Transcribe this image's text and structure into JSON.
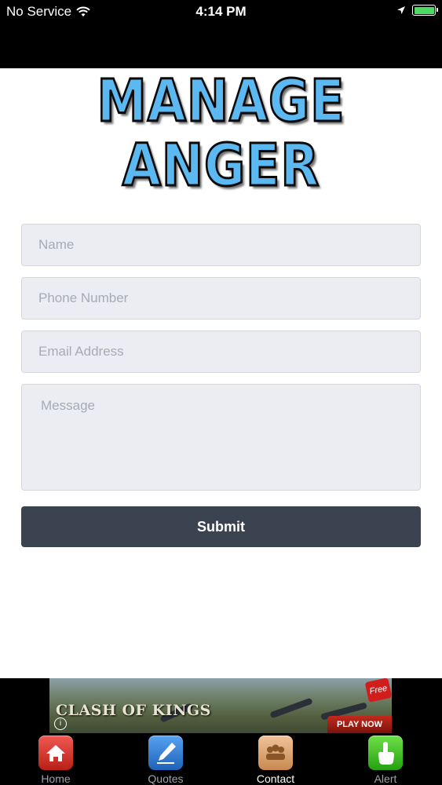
{
  "status_bar": {
    "carrier": "No Service",
    "time": "4:14 PM",
    "icons": [
      "wifi-icon",
      "location-arrow-icon",
      "battery-icon"
    ]
  },
  "logo": {
    "line1": "MANAGE",
    "line2": "ANGER",
    "color": "#5cb8f0"
  },
  "form": {
    "name_placeholder": "Name",
    "phone_placeholder": "Phone Number",
    "email_placeholder": "Email Address",
    "message_placeholder": "Message",
    "submit_label": "Submit"
  },
  "ad": {
    "title": "CLASH OF KINGS",
    "cta": "PLAY NOW",
    "badge": "Free"
  },
  "tabs": [
    {
      "label": "Home",
      "icon": "home-icon",
      "color": "#d9342b"
    },
    {
      "label": "Quotes",
      "icon": "quill-pen-icon",
      "color": "#2f7fd9"
    },
    {
      "label": "Contact",
      "icon": "contacts-icon",
      "color": "#e2a468",
      "active": true
    },
    {
      "label": "Alert",
      "icon": "hand-pointer-icon",
      "color": "#3cb71f"
    }
  ]
}
